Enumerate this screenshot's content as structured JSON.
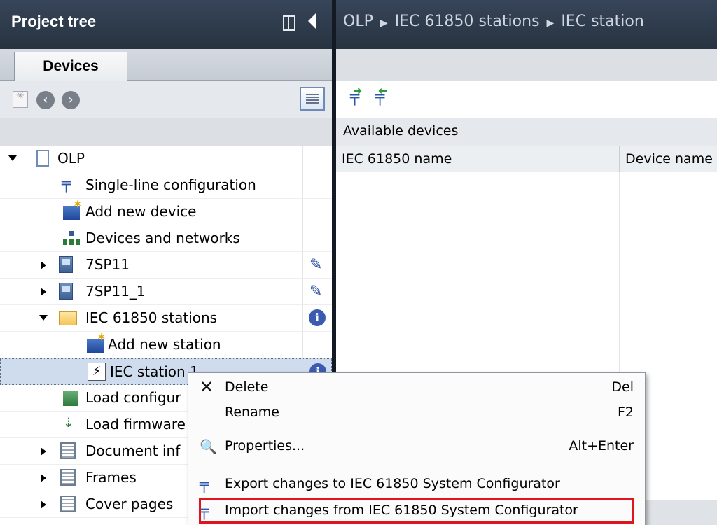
{
  "left_panel": {
    "title": "Project tree",
    "tab": "Devices"
  },
  "tree": {
    "root": "OLP",
    "items": [
      {
        "label": "Single-line configuration",
        "icon": "single-line-icon"
      },
      {
        "label": "Add new device",
        "icon": "add-device-icon"
      },
      {
        "label": "Devices and networks",
        "icon": "network-icon"
      },
      {
        "label": "7SP11",
        "icon": "device-icon"
      },
      {
        "label": "7SP11_1",
        "icon": "device-icon"
      },
      {
        "label": "IEC 61850 stations",
        "icon": "folder-icon"
      },
      {
        "label": "Add new station",
        "icon": "add-station-icon"
      },
      {
        "label": "IEC station 1",
        "icon": "station-icon"
      },
      {
        "label": "Load configur",
        "icon": "load-config-icon"
      },
      {
        "label": "Load firmware",
        "icon": "load-firmware-icon"
      },
      {
        "label": "Document inf",
        "icon": "document-icon"
      },
      {
        "label": "Frames",
        "icon": "frames-icon"
      },
      {
        "label": "Cover pages",
        "icon": "cover-pages-icon"
      }
    ]
  },
  "breadcrumb": [
    "OLP",
    "IEC 61850 stations",
    "IEC station"
  ],
  "right_panel": {
    "section_title": "Available devices",
    "columns": [
      "IEC 61850 name",
      "Device name"
    ]
  },
  "context_menu": {
    "delete": {
      "label": "Delete",
      "shortcut": "Del"
    },
    "rename": {
      "label": "Rename",
      "shortcut": "F2"
    },
    "properties": {
      "label": "Properties...",
      "shortcut": "Alt+Enter"
    },
    "export": {
      "label": "Export changes to IEC 61850 System Configurator"
    },
    "import": {
      "label": "Import changes from IEC 61850 System Configurator"
    }
  },
  "colors": {
    "header_bg": "#2f3b4b",
    "selection": "#cfdcee",
    "highlight": "#e0141e"
  }
}
